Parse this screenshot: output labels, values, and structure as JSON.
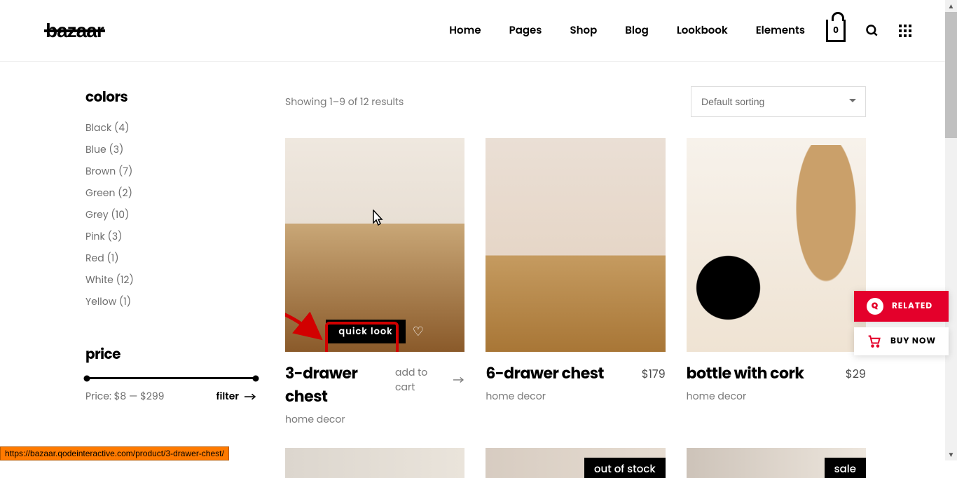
{
  "header": {
    "logo": "bazaar",
    "nav": [
      "Home",
      "Pages",
      "Shop",
      "Blog",
      "Lookbook",
      "Elements"
    ],
    "cart_count": "0"
  },
  "sidebar": {
    "colors_heading": "colors",
    "colors": [
      {
        "label": "Black (4)"
      },
      {
        "label": "Blue (3)"
      },
      {
        "label": "Brown (7)"
      },
      {
        "label": "Green (2)"
      },
      {
        "label": "Grey (10)"
      },
      {
        "label": "Pink (3)"
      },
      {
        "label": "Red (1)"
      },
      {
        "label": "White (12)"
      },
      {
        "label": "Yellow (1)"
      }
    ],
    "price_heading": "price",
    "price_label": "Price: $8 — $299",
    "filter_label": "filter"
  },
  "toolbar": {
    "results": "Showing 1–9 of 12 results",
    "sort": "Default sorting"
  },
  "products": [
    {
      "title": "3-drawer chest",
      "category": "home decor",
      "price": "",
      "action": "add to cart",
      "quick_look": "quick look",
      "hovered": true
    },
    {
      "title": "6-drawer chest",
      "category": "home decor",
      "price": "$179"
    },
    {
      "title": "bottle with cork",
      "category": "home decor",
      "price": "$29"
    }
  ],
  "badges": {
    "out_of_stock": "out of stock",
    "sale": "sale"
  },
  "float": {
    "related": "RELATED",
    "buy_now": "BUY NOW"
  },
  "url_preview": "https://bazaar.qodeinteractive.com/product/3-drawer-chest/"
}
